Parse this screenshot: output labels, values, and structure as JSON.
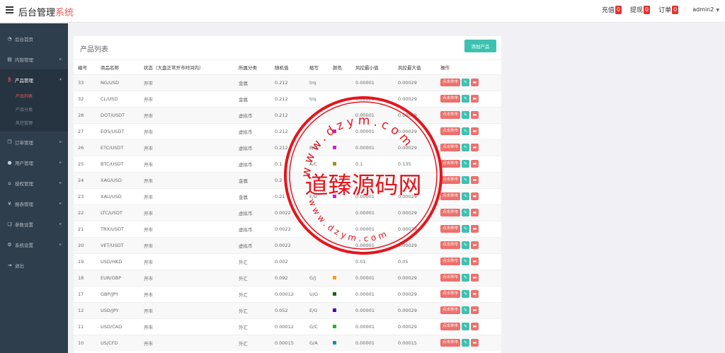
{
  "header": {
    "title_main": "后台管理",
    "title_accent": "系统",
    "recharge_label": "充值",
    "recharge_count": "0",
    "withdraw_label": "提现",
    "withdraw_count": "0",
    "orders_label": "订单",
    "orders_count": "0",
    "user_name": "admin2"
  },
  "sidebar": {
    "items": [
      {
        "label": "后台首页",
        "icon": "dashboard-icon"
      },
      {
        "label": "内容管理",
        "icon": "list-icon"
      },
      {
        "label": "产品管理",
        "icon": "bitcoin-icon"
      },
      {
        "label": "订单管理",
        "icon": "document-icon"
      },
      {
        "label": "用户管理",
        "icon": "user-icon"
      },
      {
        "label": "授权管理",
        "icon": "bank-icon"
      },
      {
        "label": "报表管理",
        "icon": "yen-icon"
      },
      {
        "label": "参数设置",
        "icon": "copy-icon"
      },
      {
        "label": "系统设置",
        "icon": "gear-icon"
      },
      {
        "label": "退出",
        "icon": "logout-icon"
      }
    ],
    "product_sub": [
      "产品列表",
      "产品分类",
      "风控管理"
    ]
  },
  "panel": {
    "title": "产品列表",
    "add_button": "添加产品",
    "columns": [
      "编号",
      "商品名称",
      "状态（大盘正常开市时间内）",
      "所属分类",
      "随机值",
      "缩写",
      "颜色",
      "风控最小值",
      "风控最大值",
      "操作"
    ],
    "action_open": "点击休市",
    "rows": [
      {
        "id": "33",
        "name": "NG/USD",
        "status": "开市",
        "category": "金属",
        "random": "0.212",
        "abbr": "trq",
        "color": "",
        "min": "0.00001",
        "max": "0.00029"
      },
      {
        "id": "32",
        "name": "CL/USD",
        "status": "开市",
        "category": "金属",
        "random": "0.212",
        "abbr": "trq",
        "color": "",
        "min": "0.00001",
        "max": "0.00029"
      },
      {
        "id": "28",
        "name": "DOT/USDT",
        "status": "开市",
        "category": "虚拟币",
        "random": "0.212",
        "abbr": "",
        "color": "",
        "min": "0.00001",
        "max": "0.00029"
      },
      {
        "id": "27",
        "name": "EOS/USDT",
        "status": "开市",
        "category": "虚拟币",
        "random": "0.212",
        "abbr": "",
        "color": "#cc22cc",
        "min": "0.00001",
        "max": "0.00029"
      },
      {
        "id": "26",
        "name": "ETC/USDT",
        "status": "开市",
        "category": "虚拟币",
        "random": "0.212",
        "abbr": "E/U",
        "color": "#cc22cc",
        "min": "0.00001",
        "max": "0.00029"
      },
      {
        "id": "25",
        "name": "BTC/USDT",
        "status": "开市",
        "category": "虚拟币",
        "random": "0.1",
        "abbr": "A/C",
        "color": "#8a9a22",
        "min": "0.1",
        "max": "0.135"
      },
      {
        "id": "24",
        "name": "XAG/USD",
        "status": "开市",
        "category": "金属",
        "random": "0.2",
        "abbr": "",
        "color": "",
        "min": "",
        "max": ""
      },
      {
        "id": "23",
        "name": "XAU/USD",
        "status": "开市",
        "category": "金属",
        "random": "0.21",
        "abbr": "E/U",
        "color": "#cc22cc",
        "min": "0.00001",
        "max": "0.00029"
      },
      {
        "id": "22",
        "name": "LTC/USDT",
        "status": "开市",
        "category": "虚拟币",
        "random": "0.0022",
        "abbr": "",
        "color": "",
        "min": "0.00001",
        "max": "0.00029"
      },
      {
        "id": "21",
        "name": "TRX/USDT",
        "status": "开市",
        "category": "虚拟币",
        "random": "0.0022",
        "abbr": "",
        "color": "",
        "min": "0.00001",
        "max": "0.00029"
      },
      {
        "id": "20",
        "name": "VET/USDT",
        "status": "开市",
        "category": "虚拟币",
        "random": "0.0022",
        "abbr": "",
        "color": "",
        "min": "0.00001",
        "max": "0.00029"
      },
      {
        "id": "19",
        "name": "USD/HKD",
        "status": "开市",
        "category": "外汇",
        "random": "0.002",
        "abbr": "",
        "color": "",
        "min": "0.01",
        "max": "0.05"
      },
      {
        "id": "18",
        "name": "EUR/GBP",
        "status": "开市",
        "category": "外汇",
        "random": "0.092",
        "abbr": "G/J",
        "color": "#f0a020",
        "min": "0.00001",
        "max": "0.00029"
      },
      {
        "id": "17",
        "name": "GBP/JPY",
        "status": "开市",
        "category": "外汇",
        "random": "0.00012",
        "abbr": "U/G",
        "color": "#116611",
        "min": "0.00001",
        "max": "0.00029"
      },
      {
        "id": "12",
        "name": "USD/JPY",
        "status": "开市",
        "category": "外汇",
        "random": "0.052",
        "abbr": "E/G",
        "color": "#5500aa",
        "min": "0.00001",
        "max": "0.00029"
      },
      {
        "id": "11",
        "name": "USD/CAD",
        "status": "开市",
        "category": "外汇",
        "random": "0.00012",
        "abbr": "G/C",
        "color": "#22bb22",
        "min": "0.00001",
        "max": "0.00029"
      },
      {
        "id": "10",
        "name": "US/CFD",
        "status": "开市",
        "category": "外汇",
        "random": "0.00015",
        "abbr": "G/A",
        "color": "#119999",
        "min": "0.00001",
        "max": "0.00015"
      }
    ]
  },
  "watermark": {
    "text": "道臻源码网",
    "url_top": "www.dzym.com",
    "url_bottom": "www.dzym.com",
    "color": "#e4161d"
  }
}
